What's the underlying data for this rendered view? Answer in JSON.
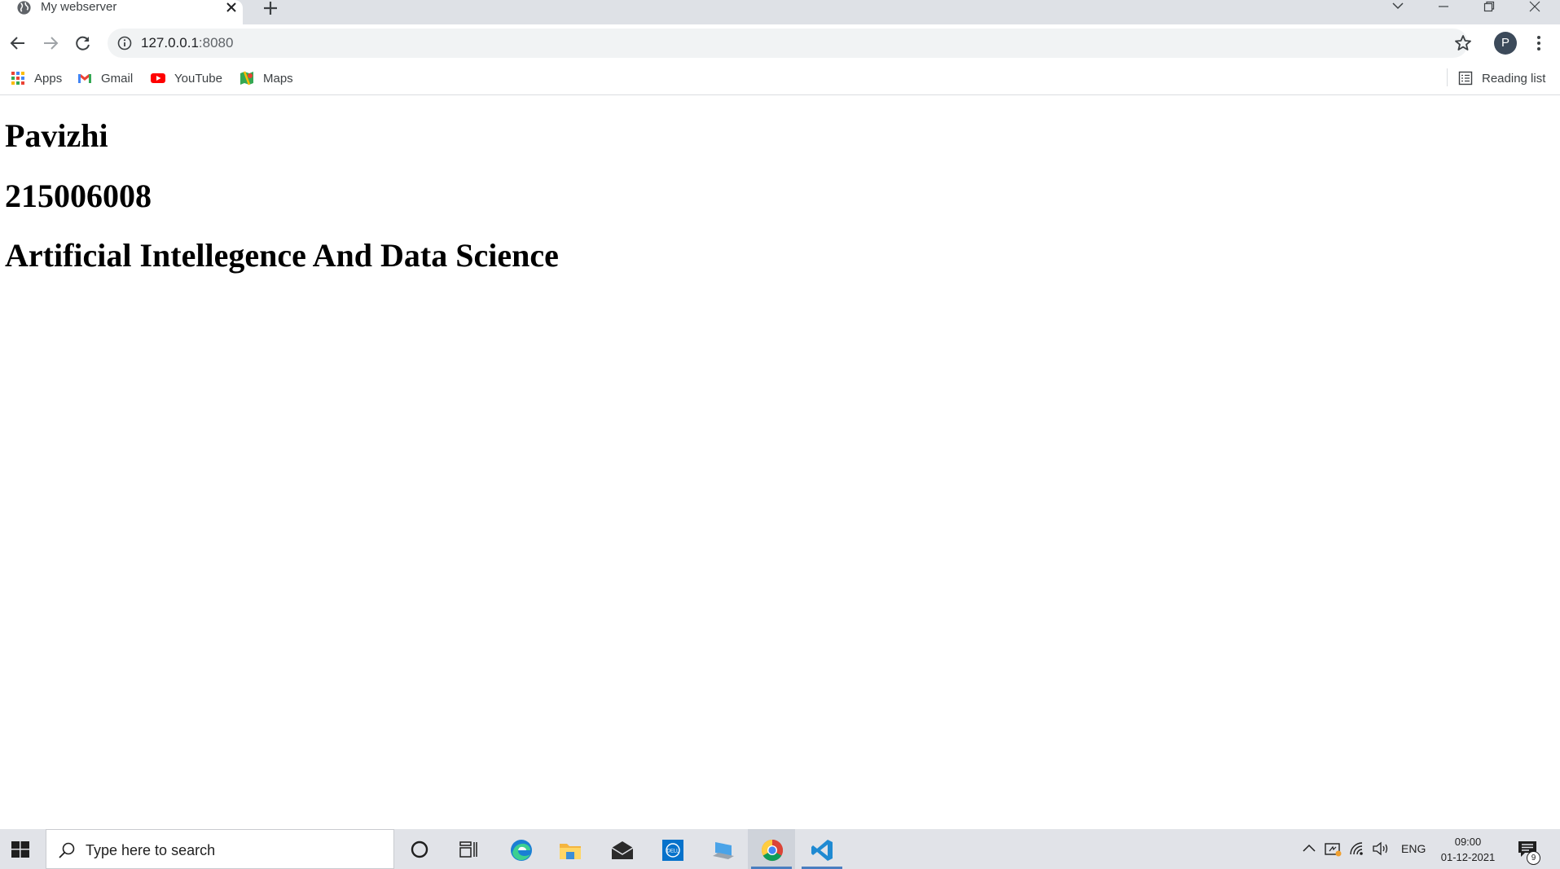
{
  "browser": {
    "tab": {
      "title": "My webserver",
      "favicon": "globe-icon"
    },
    "url": {
      "host": "127.0.0.1",
      "port": ":8080"
    },
    "profile_initial": "P",
    "bookmarks": [
      {
        "label": "Apps",
        "icon": "apps-grid-icon"
      },
      {
        "label": "Gmail",
        "icon": "gmail-icon"
      },
      {
        "label": "YouTube",
        "icon": "youtube-icon"
      },
      {
        "label": "Maps",
        "icon": "maps-icon"
      }
    ],
    "reading_list_label": "Reading list"
  },
  "page": {
    "headings": [
      "Pavizhi",
      "215006008",
      "Artificial Intellegence And Data Science"
    ]
  },
  "taskbar": {
    "search_placeholder": "Type here to search",
    "pinned_apps": [
      "cortana",
      "task-view",
      "edge",
      "file-explorer",
      "mail",
      "dell",
      "laptop",
      "chrome",
      "vscode"
    ],
    "active_app": "vscode",
    "tray": {
      "language": "ENG",
      "time": "09:00",
      "date": "01-12-2021",
      "notification_count": "9"
    }
  },
  "colors": {
    "tabstrip_bg": "#dee1e6",
    "omnibox_bg": "#f1f3f4",
    "taskbar_bg": "#e1e3e8",
    "accent": "#4a7ec0"
  }
}
